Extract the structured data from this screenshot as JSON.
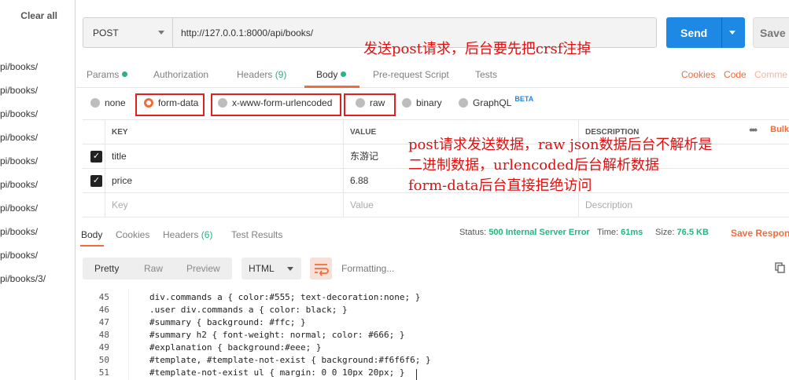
{
  "sidebar": {
    "clear_all": "Clear all",
    "history": [
      "pi/books/",
      "pi/books/",
      "pi/books/",
      "pi/books/",
      "pi/books/",
      "pi/books/",
      "pi/books/",
      "pi/books/",
      "pi/books/",
      "pi/books/3/"
    ]
  },
  "request": {
    "method": "POST",
    "url": "http://127.0.0.1:8000/api/books/",
    "send": "Send",
    "save": "Save"
  },
  "tabs": {
    "params": "Params",
    "authorization": "Authorization",
    "headers": "Headers",
    "headers_count": "(9)",
    "body": "Body",
    "prerequest": "Pre-request Script",
    "tests": "Tests",
    "cookies": "Cookies",
    "code": "Code",
    "comments": "Comme"
  },
  "body_types": {
    "none": "none",
    "form_data": "form-data",
    "urlencoded": "x-www-form-urlencoded",
    "raw": "raw",
    "binary": "binary",
    "graphql": "GraphQL",
    "beta": "BETA"
  },
  "kv_table": {
    "headers": {
      "key": "KEY",
      "value": "VALUE",
      "description": "DESCRIPTION",
      "more": "•••",
      "bulk": "Bulk"
    },
    "rows": [
      {
        "key": "title",
        "value": "东游记"
      },
      {
        "key": "price",
        "value": "6.88"
      }
    ],
    "placeholder": {
      "key": "Key",
      "value": "Value",
      "description": "Description"
    }
  },
  "response": {
    "tabs": {
      "body": "Body",
      "cookies": "Cookies",
      "headers": "Headers",
      "headers_count": "(6)",
      "test_results": "Test Results"
    },
    "status_label": "Status:",
    "status_value": "500 Internal Server Error",
    "time_label": "Time:",
    "time_value": "61ms",
    "size_label": "Size:",
    "size_value": "76.5 KB",
    "save_response": "Save Respons",
    "format_buttons": {
      "pretty": "Pretty",
      "raw": "Raw",
      "preview": "Preview"
    },
    "language": "HTML",
    "formatting": "Formatting...",
    "code_lines": [
      {
        "n": "45",
        "text": "div.commands a { color:#555; text-decoration:none; }"
      },
      {
        "n": "46",
        "text": ".user div.commands a { color: black; }"
      },
      {
        "n": "47",
        "text": "#summary { background: #ffc; }"
      },
      {
        "n": "48",
        "text": "#summary h2 { font-weight: normal; color: #666; }"
      },
      {
        "n": "49",
        "text": "#explanation { background:#eee; }"
      },
      {
        "n": "50",
        "text": "#template, #template-not-exist { background:#f6f6f6; }"
      },
      {
        "n": "51",
        "text": "#template-not-exist ul { margin: 0 0 10px 20px; }"
      }
    ]
  },
  "annotations": {
    "note1": "发送post请求，后台要先把crsf注掉",
    "note2_line1": "post请求发送数据，raw json数据后台不解析是",
    "note2_line2": "二进制数据，urlencoded后台解析数据",
    "note2_line3": "form-data后台直接拒绝访问"
  },
  "colors": {
    "accent": "#f26b3a",
    "send_blue": "#1e88e5",
    "success_green": "#26b47f",
    "annotation_red": "#e01010"
  }
}
